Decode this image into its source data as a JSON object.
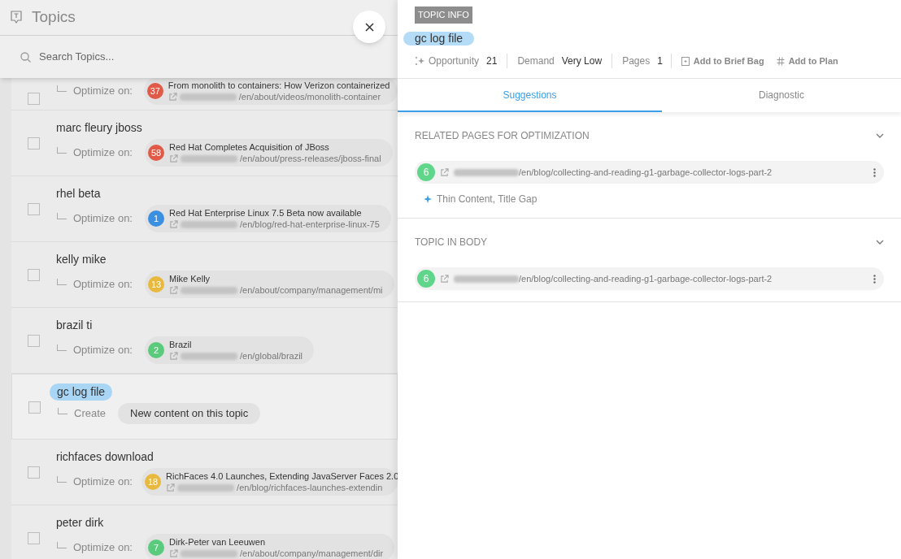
{
  "header": {
    "title": "Topics",
    "search": {
      "placeholder": "Search Topics..."
    }
  },
  "topics": [
    {
      "selected": false,
      "action": {
        "kind": "optimize",
        "label": "Optimize on:",
        "page": {
          "score": "37",
          "color": "#e05a47",
          "title": "From monolith to containers: How Verizon containerized",
          "url": "/en/about/videos/monolith-container"
        }
      }
    },
    {
      "topic": "marc fleury jboss",
      "selected": false,
      "action": {
        "kind": "optimize",
        "label": "Optimize on:",
        "page": {
          "score": "58",
          "color": "#e05a47",
          "title": "Red Hat Completes Acquisition of JBoss",
          "url": "/en/about/press-releases/jboss-final"
        }
      }
    },
    {
      "topic": "rhel beta",
      "selected": false,
      "action": {
        "kind": "optimize",
        "label": "Optimize on:",
        "page": {
          "score": "1",
          "color": "#3b8fe0",
          "title": "Red Hat Enterprise Linux 7.5 Beta now available",
          "url": "/en/blog/red-hat-enterprise-linux-75"
        }
      }
    },
    {
      "topic": "kelly mike",
      "selected": false,
      "action": {
        "kind": "optimize",
        "label": "Optimize on:",
        "page": {
          "score": "13",
          "color": "#e9b93f",
          "title": "Mike Kelly",
          "url": "/en/about/company/management/mi"
        }
      }
    },
    {
      "topic": "brazil ti",
      "selected": false,
      "action": {
        "kind": "optimize",
        "label": "Optimize on:",
        "page": {
          "score": "2",
          "color": "#5acb7c",
          "title": "Brazil",
          "url": "/en/global/brazil"
        }
      }
    },
    {
      "topic": "gc log file",
      "selected": true,
      "action": {
        "kind": "create",
        "label": "Create",
        "button": "New content on this topic"
      }
    },
    {
      "topic": "richfaces download",
      "selected": false,
      "action": {
        "kind": "optimize",
        "label": "Optimize on:",
        "page": {
          "score": "18",
          "color": "#e9b93f",
          "title": "RichFaces 4.0 Launches, Extending JavaServer Faces 2.0",
          "url": "/en/blog/richfaces-launches-extendin"
        }
      }
    },
    {
      "topic": "peter dirk",
      "selected": false,
      "action": {
        "kind": "optimize",
        "label": "Optimize on:",
        "page": {
          "score": "7",
          "color": "#5acb7c",
          "title": "Dirk-Peter van Leeuwen",
          "url": "/en/about/company/management/dir"
        }
      }
    }
  ],
  "detail": {
    "tag": "TOPIC INFO",
    "title": "gc log file",
    "metrics": [
      {
        "kind": "sparkle-stat",
        "label": "Opportunity",
        "value": "21"
      },
      {
        "kind": "stat",
        "label": "Demand",
        "value": "Very Low"
      },
      {
        "kind": "stat",
        "label": "Pages",
        "value": "1"
      },
      {
        "kind": "bag-action",
        "label": "Add to Brief Bag"
      },
      {
        "kind": "plan-action",
        "label": "Add to Plan"
      }
    ],
    "tabs": [
      {
        "label": "Suggestions",
        "selected": true
      },
      {
        "label": "Diagnostic",
        "selected": false
      }
    ],
    "sections": [
      {
        "title": "RELATED PAGES FOR OPTIMIZATION",
        "expanded": true,
        "pages": [
          {
            "score": "6",
            "color": "#5fd68a",
            "url": "/en/blog/collecting-and-reading-g1-garbage-collector-logs-part-2"
          }
        ],
        "issues": "Thin Content, Title Gap"
      },
      {
        "title": "TOPIC IN BODY",
        "expanded": true,
        "pages": [
          {
            "score": "6",
            "color": "#5fd68a",
            "url": "/en/blog/collecting-and-reading-g1-garbage-collector-logs-part-2"
          }
        ]
      }
    ]
  }
}
